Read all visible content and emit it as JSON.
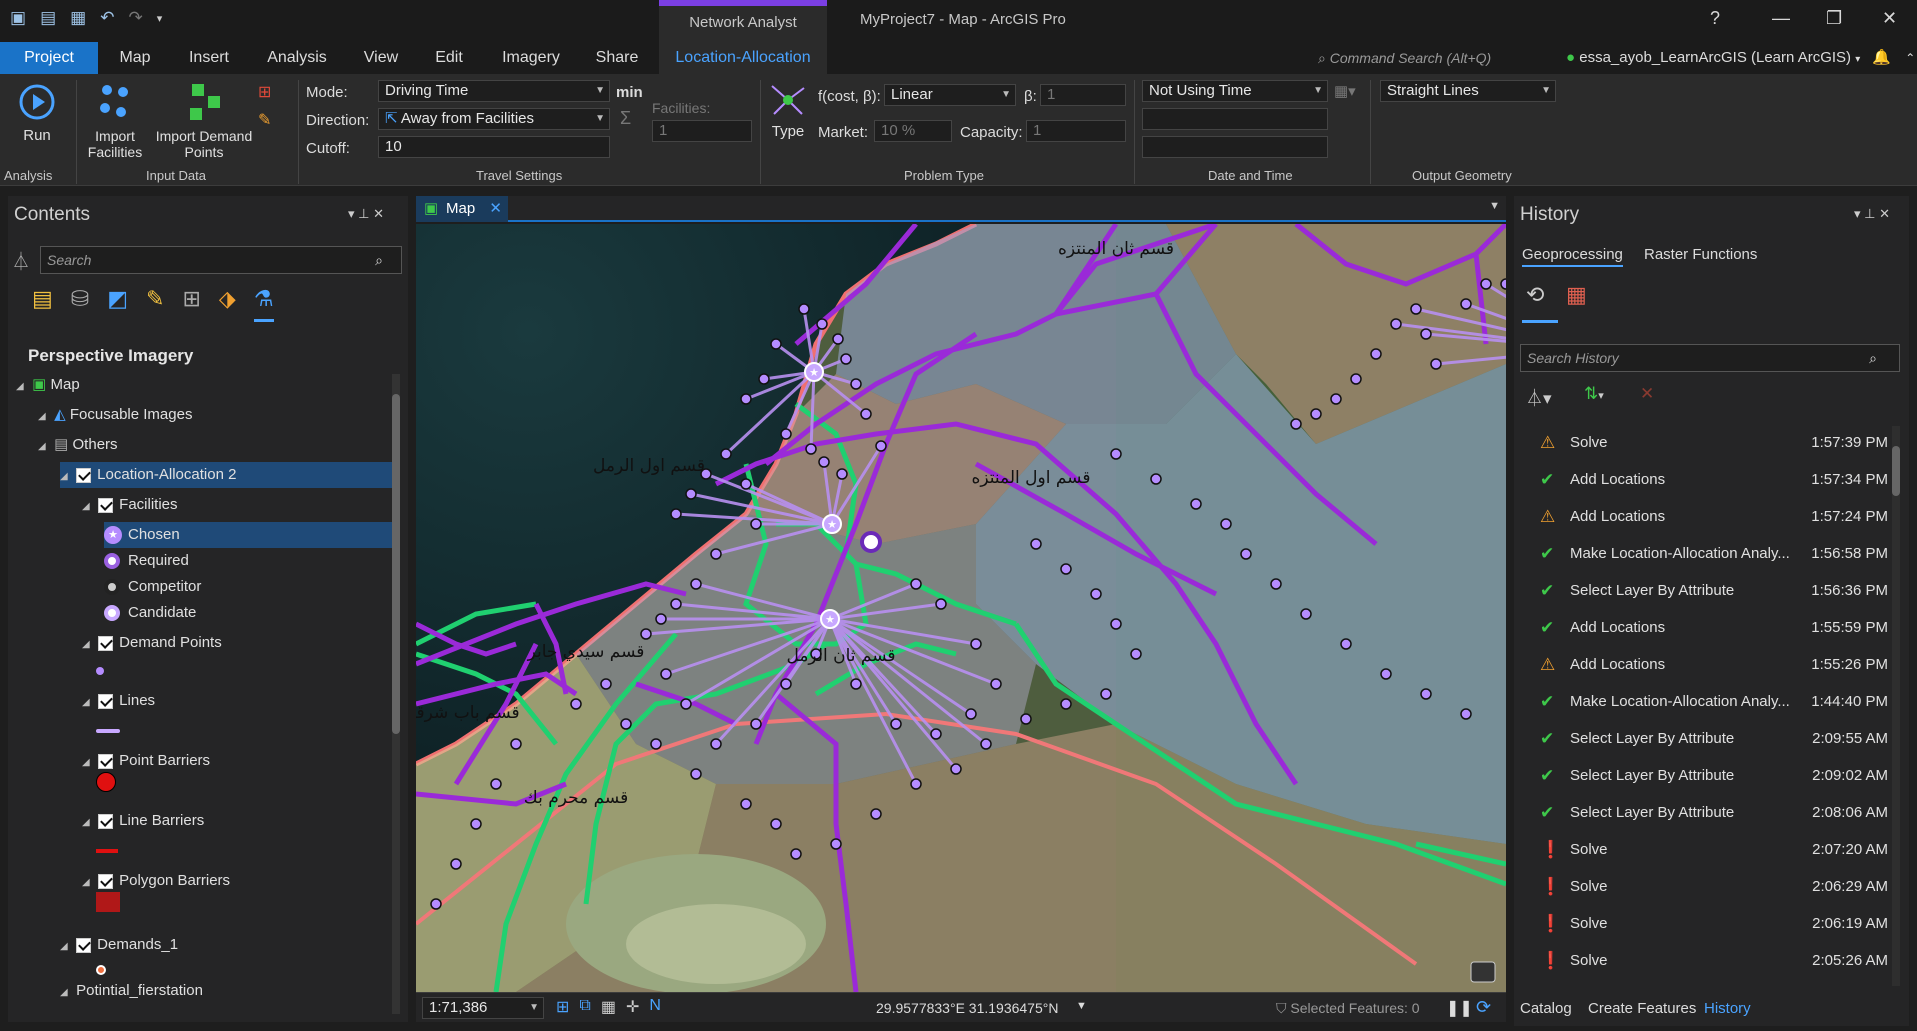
{
  "titlebar": {
    "context_tab": "Network Analyst",
    "window_title": "MyProject7 - Map - ArcGIS Pro",
    "help": "?",
    "minimize": "—",
    "maximize": "❐",
    "close": "✕"
  },
  "tabs": [
    "Project",
    "Map",
    "Insert",
    "Analysis",
    "View",
    "Edit",
    "Imagery",
    "Share",
    "Location-Allocation"
  ],
  "command_search": {
    "placeholder": "Command Search (Alt+Q)"
  },
  "user": {
    "label": "essa_ayob_LearnArcGIS (Learn ArcGIS)"
  },
  "ribbon": {
    "run_label": "Run",
    "import_facilities_label": "Import Facilities",
    "import_demand_label": "Import Demand Points",
    "mode_label": "Mode:",
    "mode_value": "Driving Time",
    "mode_unit": "min",
    "direction_label": "Direction:",
    "direction_value": "Away from Facilities",
    "cutoff_label": "Cutoff:",
    "cutoff_value": "10",
    "facilities_label": "Facilities:",
    "facilities_value": "1",
    "type_label": "Type",
    "fcost_label": "f(cost, β):",
    "fcost_value": "Linear",
    "beta_label": "β:",
    "beta_value": "1",
    "market_label": "Market:",
    "market_value": "10  %",
    "capacity_label": "Capacity:",
    "capacity_value": "1",
    "time_value": "Not Using Time",
    "geometry_value": "Straight Lines",
    "groups": {
      "analysis": "Analysis",
      "input": "Input Data",
      "travel": "Travel Settings",
      "problem": "Problem Type",
      "datetime": "Date and Time",
      "output": "Output Geometry"
    }
  },
  "contents": {
    "title": "Contents",
    "search_placeholder": "Search",
    "section_title": "Perspective Imagery",
    "tree": [
      {
        "label": "Map",
        "indent": 0,
        "check": false,
        "selected": false,
        "icon": "map-icon"
      },
      {
        "label": "Focusable Images",
        "indent": 1,
        "check": false,
        "selected": false,
        "icon": "imagery-icon"
      },
      {
        "label": "Others",
        "indent": 1,
        "check": false,
        "selected": false,
        "icon": "group-icon"
      },
      {
        "label": "Location-Allocation 2",
        "indent": 2,
        "check": true,
        "selected": true,
        "icon": ""
      },
      {
        "label": "Facilities",
        "indent": 3,
        "check": true,
        "selected": false,
        "icon": ""
      },
      {
        "label": "Chosen",
        "indent": 4,
        "check": false,
        "selected": true,
        "icon": "star-circle"
      },
      {
        "label": "Required",
        "indent": 4,
        "check": false,
        "selected": false,
        "icon": "ring-purple"
      },
      {
        "label": "Competitor",
        "indent": 4,
        "check": false,
        "selected": false,
        "icon": "ring-dark"
      },
      {
        "label": "Candidate",
        "indent": 4,
        "check": false,
        "selected": false,
        "icon": "ring-light"
      },
      {
        "label": "Demand Points",
        "indent": 3,
        "check": true,
        "selected": false,
        "icon": ""
      },
      {
        "label": "Lines",
        "indent": 3,
        "check": true,
        "selected": false,
        "icon": ""
      },
      {
        "label": "Point Barriers",
        "indent": 3,
        "check": true,
        "selected": false,
        "icon": ""
      },
      {
        "label": "Line Barriers",
        "indent": 3,
        "check": true,
        "selected": false,
        "icon": ""
      },
      {
        "label": "Polygon Barriers",
        "indent": 3,
        "check": true,
        "selected": false,
        "icon": ""
      },
      {
        "label": "Demands_1",
        "indent": 2,
        "check": true,
        "selected": false,
        "icon": ""
      },
      {
        "label": "Potintial_fierstation",
        "indent": 2,
        "check": false,
        "selected": false,
        "icon": ""
      }
    ]
  },
  "map": {
    "tab_label": "Map",
    "labels": [
      "قسم ثان المنتزه",
      "قسم اول الرمل",
      "قسم اول المنتزه",
      "قسم سيدي جابر",
      "قسم ثان الرمل",
      "قسم باب شرقي",
      "قسم محرم بك"
    ],
    "scale": "1:71,386",
    "coords": "29.9577833°E 31.1936475°N",
    "selected_features": "Selected Features: 0"
  },
  "history": {
    "title": "History",
    "tabs": [
      "Geoprocessing",
      "Raster Functions"
    ],
    "search_placeholder": "Search History",
    "rows": [
      {
        "status": "warn",
        "name": "Solve",
        "time": "1:57:39 PM"
      },
      {
        "status": "ok",
        "name": "Add Locations",
        "time": "1:57:34 PM"
      },
      {
        "status": "warn",
        "name": "Add Locations",
        "time": "1:57:24 PM"
      },
      {
        "status": "ok",
        "name": "Make Location-Allocation Analy...",
        "time": "1:56:58 PM"
      },
      {
        "status": "ok",
        "name": "Select Layer By Attribute",
        "time": "1:56:36 PM"
      },
      {
        "status": "ok",
        "name": "Add Locations",
        "time": "1:55:59 PM"
      },
      {
        "status": "warn",
        "name": "Add Locations",
        "time": "1:55:26 PM"
      },
      {
        "status": "ok",
        "name": "Make Location-Allocation Analy...",
        "time": "1:44:40 PM"
      },
      {
        "status": "ok",
        "name": "Select Layer By Attribute",
        "time": "2:09:55 AM"
      },
      {
        "status": "ok",
        "name": "Select Layer By Attribute",
        "time": "2:09:02 AM"
      },
      {
        "status": "ok",
        "name": "Select Layer By Attribute",
        "time": "2:08:06 AM"
      },
      {
        "status": "err",
        "name": "Solve",
        "time": "2:07:20 AM"
      },
      {
        "status": "err",
        "name": "Solve",
        "time": "2:06:29 AM"
      },
      {
        "status": "err",
        "name": "Solve",
        "time": "2:06:19 AM"
      },
      {
        "status": "err",
        "name": "Solve",
        "time": "2:05:26 AM"
      }
    ]
  },
  "bottom_tabs": [
    "Catalog",
    "Create Features",
    "History"
  ]
}
